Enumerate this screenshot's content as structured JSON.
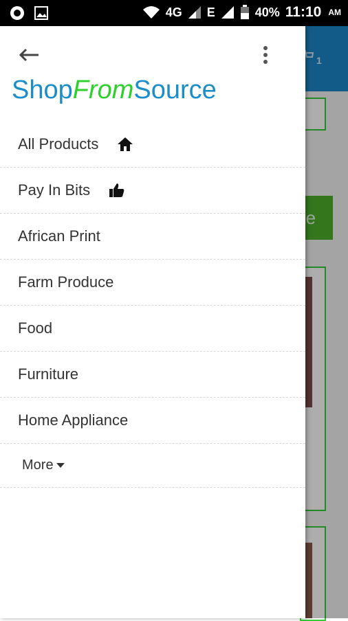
{
  "status_bar": {
    "network": "4G",
    "network2": "E",
    "battery": "40%",
    "time": "11:10",
    "ampm": "AM"
  },
  "background": {
    "cart_count": "1",
    "green_button_text": "re"
  },
  "drawer": {
    "brand": {
      "part1": "Shop",
      "part2": "From",
      "part3": "Source"
    },
    "items": [
      {
        "label": "All Products",
        "icon": "home-icon"
      },
      {
        "label": "Pay In Bits",
        "icon": "thumbs-up-icon"
      },
      {
        "label": "African Print"
      },
      {
        "label": "Farm Produce"
      },
      {
        "label": "Food"
      },
      {
        "label": "Furniture"
      },
      {
        "label": "Home Appliance"
      }
    ],
    "more_label": "More"
  },
  "colors": {
    "brand_blue": "#1b8ec9",
    "brand_green": "#2cd12c",
    "appbar_blue": "#1b87c9"
  }
}
